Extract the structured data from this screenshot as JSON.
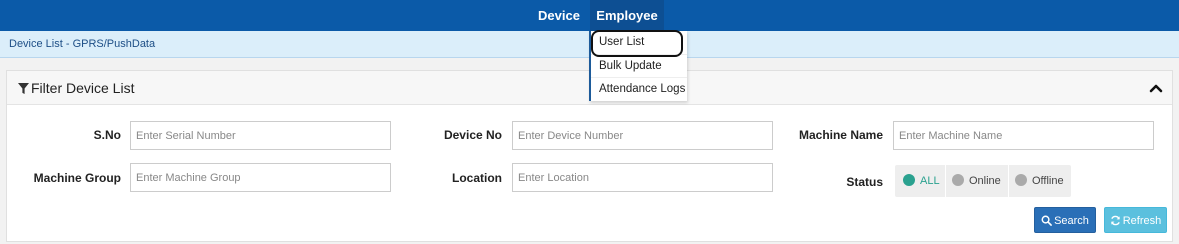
{
  "nav": {
    "device": "Device",
    "employee": "Employee"
  },
  "breadcrumb": "Device List - GPRS/PushData",
  "panel": {
    "title": "Filter Device List"
  },
  "fields": {
    "sno": {
      "label": "S.No",
      "placeholder": "Enter Serial Number"
    },
    "device_no": {
      "label": "Device No",
      "placeholder": "Enter Device Number"
    },
    "machine_name": {
      "label": "Machine Name",
      "placeholder": "Enter Machine Name"
    },
    "machine_group": {
      "label": "Machine Group",
      "placeholder": "Enter Machine Group"
    },
    "location": {
      "label": "Location",
      "placeholder": "Enter Location"
    }
  },
  "status": {
    "label": "Status",
    "options": [
      "ALL",
      "Online",
      "Offline"
    ],
    "selected": "ALL"
  },
  "buttons": {
    "search": "Search",
    "refresh": "Refresh"
  },
  "dropdown": {
    "items": [
      "User List",
      "Bulk Update",
      "Attendance Logs"
    ]
  },
  "colors": {
    "nav_bg": "#0b5aa8",
    "accent_teal": "#2aa18f",
    "search_btn": "#2a6fb7",
    "refresh_btn": "#5bc0de"
  },
  "icons": [
    "filter-icon",
    "chevron-up-icon",
    "search-icon",
    "refresh-icon"
  ]
}
